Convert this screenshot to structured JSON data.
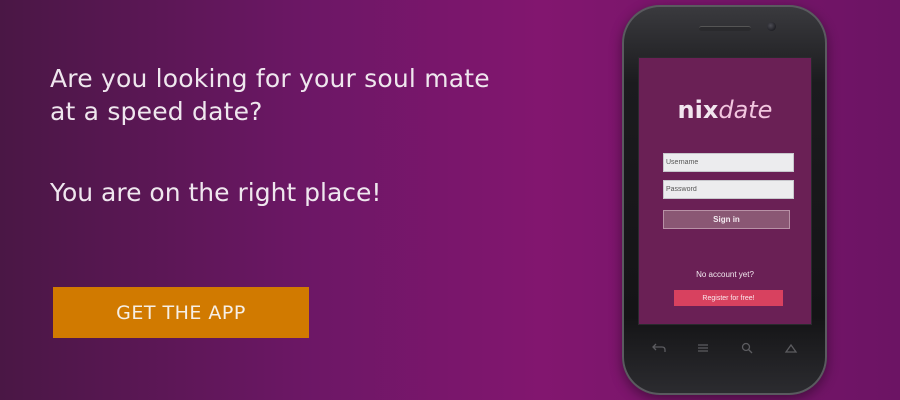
{
  "hero": {
    "headline": "Are you looking  for your soul mate\nat a speed date?",
    "subline": "You are on the right place!",
    "cta_label": "GET THE APP"
  },
  "phone": {
    "app_logo": {
      "part1": "nix",
      "part2": "date"
    },
    "username_placeholder": "Username",
    "password_placeholder": "Password",
    "signin_label": "Sign in",
    "no_account_text": "No account yet?",
    "register_label": "Register for free!",
    "nav_icons": [
      "back-icon",
      "home-icon",
      "search-icon",
      "menu-icon"
    ]
  },
  "colors": {
    "accent": "#d17a00",
    "register": "#d8415f",
    "screen_bg": "#6a2055"
  }
}
